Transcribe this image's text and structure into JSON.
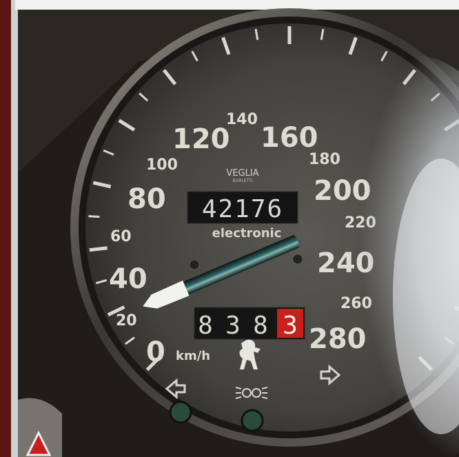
{
  "speedometer": {
    "dial_labels": [
      "0",
      "20",
      "40",
      "60",
      "80",
      "100",
      "120",
      "140",
      "160",
      "180",
      "200",
      "220",
      "240",
      "260",
      "280"
    ],
    "unit": "km/h",
    "brand": "VEGLIA",
    "brand_sub": "BORLETTI",
    "odometer": "42176",
    "odometer_caption": "electronic",
    "trip": {
      "digits": [
        "8",
        "3",
        "8"
      ],
      "last_digit": "3"
    },
    "needle_reading_kmh": 17
  },
  "colors": {
    "dial_face": "#4a4844",
    "numerals": "#dcdcd2",
    "trip_highlight": "#c8201a",
    "needle": "#1e3c3c",
    "indicator_green": "#2a4a3a"
  },
  "icons": [
    "left-turn-signal-icon",
    "right-turn-signal-icon",
    "headlight-icon",
    "prancing-horse-logo-icon",
    "hazard-triangle-icon"
  ]
}
